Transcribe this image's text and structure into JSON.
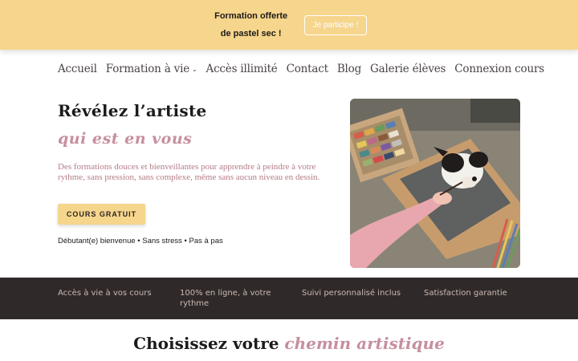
{
  "promo": {
    "text": "Formation offerte de pastel sec !",
    "button_label": "Je participe !"
  },
  "nav": {
    "items": [
      {
        "label": "Accueil"
      },
      {
        "label": "Formation à vie",
        "has_dropdown": true
      },
      {
        "label": "Accès illimité"
      },
      {
        "label": "Contact"
      },
      {
        "label": "Blog"
      },
      {
        "label": "Galerie élèves"
      },
      {
        "label": "Connexion cours"
      }
    ]
  },
  "hero": {
    "title": "Révélez l’artiste",
    "subtitle": "qui est en vous",
    "description": "Des formations douces et bienveillantes pour apprendre à peindre à votre rythme, sans pression, sans complexe, même sans aucun niveau en dessin.",
    "cta_label": "COURS GRATUIT",
    "tagline": "Débutant(e) bienvenue • Sans stress • Pas à pas"
  },
  "features": [
    {
      "label": "Accès à vie à vos cours"
    },
    {
      "label": "100% en ligne, à votre rythme"
    },
    {
      "label": "Suivi personnalisé inclus"
    },
    {
      "label": "Satisfaction garantie"
    }
  ],
  "section": {
    "title_plain": "Choisissez votre",
    "title_accent": "chemin artistique"
  },
  "colors": {
    "promo_bg": "#f6d58c",
    "accent_pink": "#c68f9e",
    "dark_band": "#2f2a29",
    "text_dark": "#1c1a1a"
  }
}
